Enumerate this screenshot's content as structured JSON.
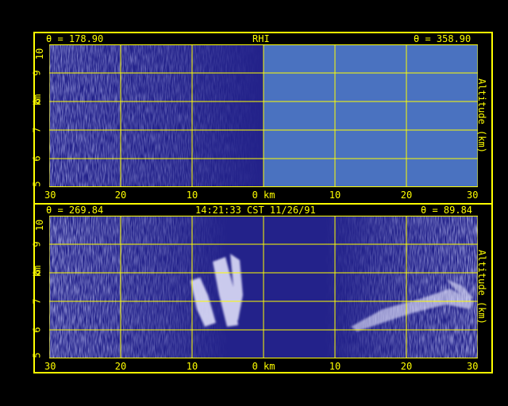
{
  "colors": {
    "accent": "#ffff00",
    "background": "#000000",
    "plot_bg": "#23228a",
    "noise_light": "#6c6fbf",
    "blank_region": "#4a72c0",
    "echo": "#e8e8ff"
  },
  "top_panel": {
    "left_angle": "θ = 178.90",
    "title": "RHI",
    "right_angle": "θ = 358.90",
    "y_ticks": [
      "10",
      "9",
      "8",
      "7",
      "6",
      "5"
    ],
    "y_unit_left": "km",
    "y_label_right": "Altitude (km)",
    "x_ticks": [
      "30",
      "20",
      "10",
      "0 km",
      "10",
      "20",
      "30"
    ]
  },
  "bottom_panel": {
    "left_angle": "θ = 269.84",
    "timestamp": "14:21:33 CST 11/26/91",
    "right_angle": "θ = 89.84",
    "y_ticks": [
      "10",
      "9",
      "8",
      "7",
      "6",
      "5"
    ],
    "y_unit_left": "km",
    "y_label_right": "Altitude (km)",
    "x_ticks": [
      "30",
      "20",
      "10",
      "0 km",
      "10",
      "20",
      "30"
    ]
  }
}
